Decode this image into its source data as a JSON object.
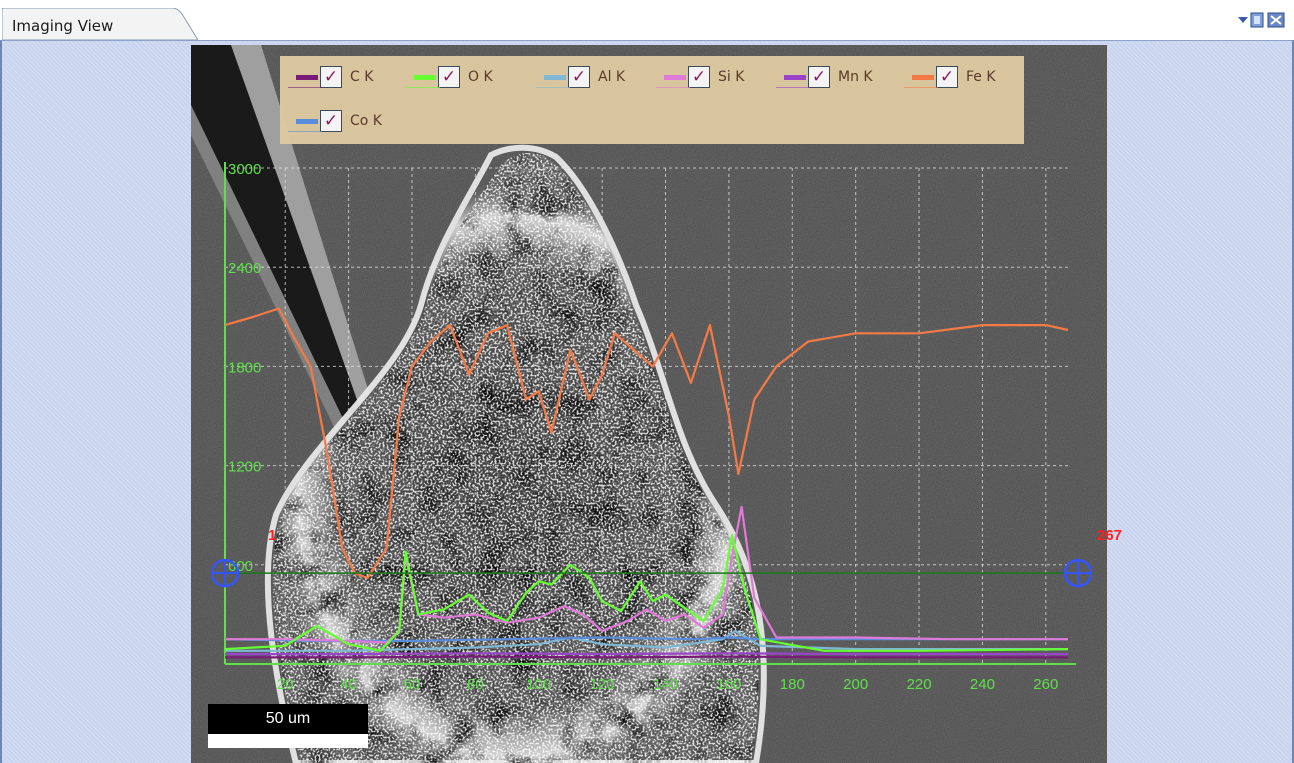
{
  "tab": {
    "title": "Imaging View"
  },
  "scale_bar": {
    "label": "50 um"
  },
  "markers": {
    "start_label": "1",
    "end_label": "267"
  },
  "legend": [
    {
      "label": "C  K",
      "color": "#7a1a7a"
    },
    {
      "label": "O  K",
      "color": "#66ff33"
    },
    {
      "label": "Al K",
      "color": "#7fb8d4"
    },
    {
      "label": "Si K",
      "color": "#e07ad8"
    },
    {
      "label": "Mn K",
      "color": "#9a44cc"
    },
    {
      "label": "Fe K",
      "color": "#f57a45"
    },
    {
      "label": "Co K",
      "color": "#5a8cdc"
    }
  ],
  "chart_data": {
    "type": "line",
    "xlim": [
      1,
      267
    ],
    "ylim": [
      0,
      3000
    ],
    "x_ticks": [
      20,
      40,
      60,
      80,
      100,
      120,
      140,
      160,
      180,
      200,
      220,
      240,
      260
    ],
    "y_ticks": [
      600,
      1200,
      1800,
      2400,
      3000
    ],
    "grid": true,
    "series": [
      {
        "name": "Fe K",
        "color": "#f57a45",
        "x": [
          1,
          10,
          18,
          22,
          28,
          33,
          38,
          42,
          46,
          52,
          56,
          60,
          66,
          72,
          78,
          84,
          90,
          96,
          100,
          104,
          110,
          116,
          120,
          124,
          130,
          136,
          142,
          148,
          154,
          160,
          163,
          168,
          175,
          185,
          200,
          220,
          240,
          260,
          267
        ],
        "y": [
          2050,
          2100,
          2150,
          2000,
          1800,
          1300,
          700,
          550,
          520,
          700,
          1500,
          1800,
          1950,
          2050,
          1750,
          2000,
          2050,
          1600,
          1650,
          1400,
          1900,
          1600,
          1750,
          2000,
          1900,
          1800,
          2000,
          1700,
          2050,
          1500,
          1150,
          1600,
          1800,
          1950,
          2000,
          2000,
          2050,
          2050,
          2020
        ]
      },
      {
        "name": "O K",
        "color": "#66ff33",
        "x": [
          1,
          20,
          30,
          40,
          50,
          56,
          58,
          62,
          70,
          78,
          84,
          90,
          96,
          100,
          104,
          110,
          116,
          120,
          126,
          132,
          136,
          140,
          146,
          152,
          158,
          161,
          165,
          170,
          190,
          220,
          267
        ],
        "y": [
          90,
          110,
          230,
          120,
          80,
          200,
          680,
          300,
          330,
          420,
          310,
          260,
          430,
          500,
          480,
          600,
          520,
          380,
          320,
          500,
          380,
          420,
          340,
          260,
          450,
          780,
          450,
          150,
          80,
          80,
          90
        ]
      },
      {
        "name": "Si K",
        "color": "#e07ad8",
        "x": [
          1,
          20,
          40,
          52,
          56,
          58,
          62,
          70,
          80,
          90,
          100,
          108,
          114,
          120,
          128,
          134,
          140,
          146,
          152,
          158,
          161,
          164,
          168,
          175,
          200,
          230,
          267
        ],
        "y": [
          150,
          150,
          140,
          130,
          200,
          650,
          300,
          280,
          300,
          250,
          280,
          350,
          300,
          200,
          260,
          330,
          260,
          300,
          220,
          300,
          650,
          950,
          400,
          160,
          160,
          150,
          150
        ]
      },
      {
        "name": "Co K",
        "color": "#5a8cdc",
        "x": [
          1,
          30,
          60,
          90,
          120,
          150,
          160,
          170,
          200,
          230,
          267
        ],
        "y": [
          150,
          140,
          140,
          150,
          160,
          150,
          160,
          150,
          150,
          150,
          150
        ]
      },
      {
        "name": "Al K",
        "color": "#7fb8d4",
        "x": [
          1,
          40,
          60,
          80,
          100,
          110,
          120,
          140,
          158,
          162,
          170,
          200,
          267
        ],
        "y": [
          80,
          80,
          90,
          100,
          120,
          160,
          120,
          100,
          150,
          200,
          110,
          90,
          90
        ]
      },
      {
        "name": "Mn K",
        "color": "#9a44cc",
        "x": [
          1,
          40,
          80,
          120,
          160,
          200,
          240,
          267
        ],
        "y": [
          60,
          60,
          65,
          60,
          65,
          60,
          60,
          60
        ]
      },
      {
        "name": "C K",
        "color": "#7a1a7a",
        "x": [
          1,
          40,
          80,
          120,
          160,
          200,
          267
        ],
        "y": [
          40,
          40,
          45,
          40,
          45,
          40,
          40
        ]
      }
    ],
    "linescan_level": 550
  }
}
